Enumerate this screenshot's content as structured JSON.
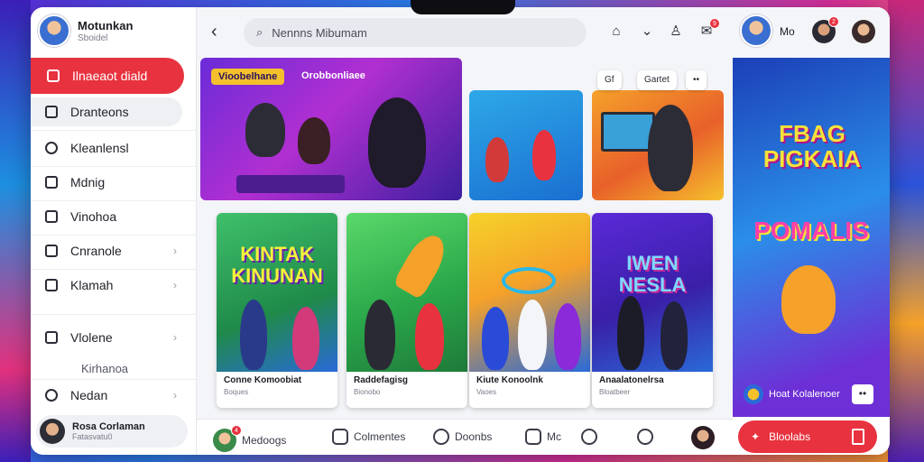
{
  "colors": {
    "accent": "#e8323f",
    "sidebar_bg": "#ffffff",
    "app_bg": "#f4f5f8"
  },
  "profile": {
    "name": "Motunkan",
    "subtitle": "Sboidel"
  },
  "sidebar": {
    "active": {
      "label": "Ilnaeaot diald",
      "icon": "home-icon"
    },
    "items": [
      {
        "label": "Dranteons",
        "icon": "calendar-icon"
      },
      {
        "label": "Kleanlensl",
        "icon": "chat-icon"
      },
      {
        "label": "Mdnig",
        "icon": "bookmark-icon"
      },
      {
        "label": "Vinohoa",
        "icon": "lock-icon"
      },
      {
        "label": "Cnranole",
        "icon": "message-icon"
      },
      {
        "label": "Klamah",
        "icon": "image-icon"
      },
      {
        "label": "Vlolene",
        "icon": "folder-icon"
      },
      {
        "label": "Kirhanoa",
        "icon": ""
      },
      {
        "label": "Nedan",
        "icon": "settings-icon"
      }
    ]
  },
  "user": {
    "name": "Rosa Corlaman",
    "subtitle": "Fatasvatu0"
  },
  "search": {
    "placeholder": "Nennns Mibumam"
  },
  "header": {
    "badge_count": "9"
  },
  "hero": {
    "tag": "Vioobelhane",
    "title": "Orobbonliaee"
  },
  "filters": {
    "pill_a": "Gf",
    "pill_b": "Gartet",
    "pill_more": "••"
  },
  "cards": [
    {
      "art_text": "KINTAK KINUNAN",
      "title": "Conne Komoobiat",
      "sub": "Boques"
    },
    {
      "art_text": "",
      "title": "Raddefagisg",
      "sub": "Bionobo"
    },
    {
      "art_text": "",
      "title": "Kiute Konoolnk",
      "sub": "Vaoes"
    },
    {
      "art_text": "IWEN NESLA",
      "title": "Anaalatonelrsa",
      "sub": "Bloatbeer"
    }
  ],
  "bottombar": {
    "items": [
      {
        "label": "Medoogs"
      },
      {
        "label": "Colmentes"
      },
      {
        "label": "Doonbs"
      },
      {
        "label": "Mc"
      }
    ],
    "badge_count": "4"
  },
  "rpanel": {
    "user": "Mo",
    "banner_line1": "FBAG PIGKAIA",
    "banner_line2": "POMALIS",
    "footer_label": "Hoat Kolalenoer",
    "more_label": "••",
    "cta_label": "Bloolabs",
    "badge_count": "2"
  }
}
